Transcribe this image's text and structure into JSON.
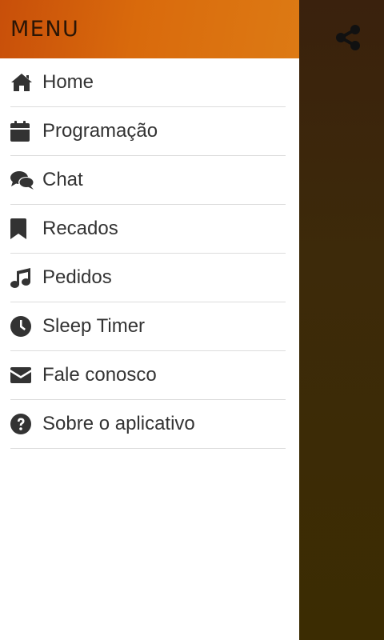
{
  "drawer": {
    "title": "MENU",
    "items": [
      {
        "label": "Home",
        "icon": "home-icon"
      },
      {
        "label": "Programação",
        "icon": "calendar-icon"
      },
      {
        "label": "Chat",
        "icon": "chat-bubbles-icon"
      },
      {
        "label": "Recados",
        "icon": "bookmark-icon"
      },
      {
        "label": "Pedidos",
        "icon": "music-note-icon"
      },
      {
        "label": "Sleep Timer",
        "icon": "clock-icon"
      },
      {
        "label": "Fale conosco",
        "icon": "envelope-icon"
      },
      {
        "label": "Sobre o aplicativo",
        "icon": "question-circle-icon"
      }
    ]
  },
  "toolbar": {
    "share_icon": "share-icon"
  },
  "colors": {
    "header_gradient_start": "#c84f0a",
    "header_gradient_end": "#dd7a14",
    "background": "#3b2a08",
    "text": "#333333",
    "divider": "#dcdcdc"
  }
}
